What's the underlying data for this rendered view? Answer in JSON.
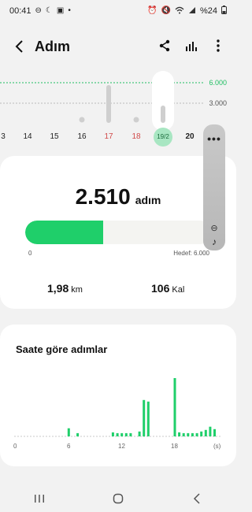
{
  "status_bar": {
    "time": "00:41",
    "battery": "%24",
    "left_icons": [
      "do-not-disturb-icon",
      "moon-icon",
      "image-icon",
      "dot-icon"
    ],
    "right_icons": [
      "alarm-icon",
      "mute-icon",
      "wifi-icon",
      "signal-icon"
    ]
  },
  "app_bar": {
    "title": "Adım"
  },
  "week_chart": {
    "scale_high": "6.000",
    "scale_mid": "3.000",
    "days": [
      {
        "label": "3",
        "style": "normal"
      },
      {
        "label": "14",
        "style": "normal"
      },
      {
        "label": "15",
        "style": "normal"
      },
      {
        "label": "16",
        "style": "normal"
      },
      {
        "label": "17",
        "style": "red"
      },
      {
        "label": "18",
        "style": "red"
      },
      {
        "label": "19/2",
        "style": "today"
      },
      {
        "label": "20",
        "style": "bold"
      }
    ]
  },
  "steps": {
    "value": "2.510",
    "unit": "adım",
    "progress": 0.42,
    "start_label": "0",
    "goal_label": "Hedef: 6.000",
    "distance": "1,98",
    "distance_unit": "km",
    "calories": "106",
    "calories_unit": "Kal"
  },
  "side_panel": {
    "dots": "•••"
  },
  "hourly": {
    "title": "Saate göre adımlar",
    "ticks": [
      "0",
      "6",
      "12",
      "18",
      "(s)"
    ]
  },
  "chart_data": {
    "type": "bar",
    "title": "Saate göre adımlar",
    "xlabel": "(s)",
    "x_ticks": [
      "0",
      "6",
      "12",
      "18"
    ],
    "x": [
      6,
      7,
      11,
      11.5,
      12,
      12.5,
      13,
      14,
      14.5,
      15,
      18,
      18.5,
      19,
      19.5,
      20,
      20.5,
      21,
      21.5,
      22,
      22.5
    ],
    "values": [
      10,
      4,
      5,
      4,
      4,
      4,
      4,
      6,
      45,
      43,
      72,
      5,
      4,
      4,
      4,
      4,
      6,
      8,
      12,
      9
    ],
    "color": "#1fcf6a"
  }
}
